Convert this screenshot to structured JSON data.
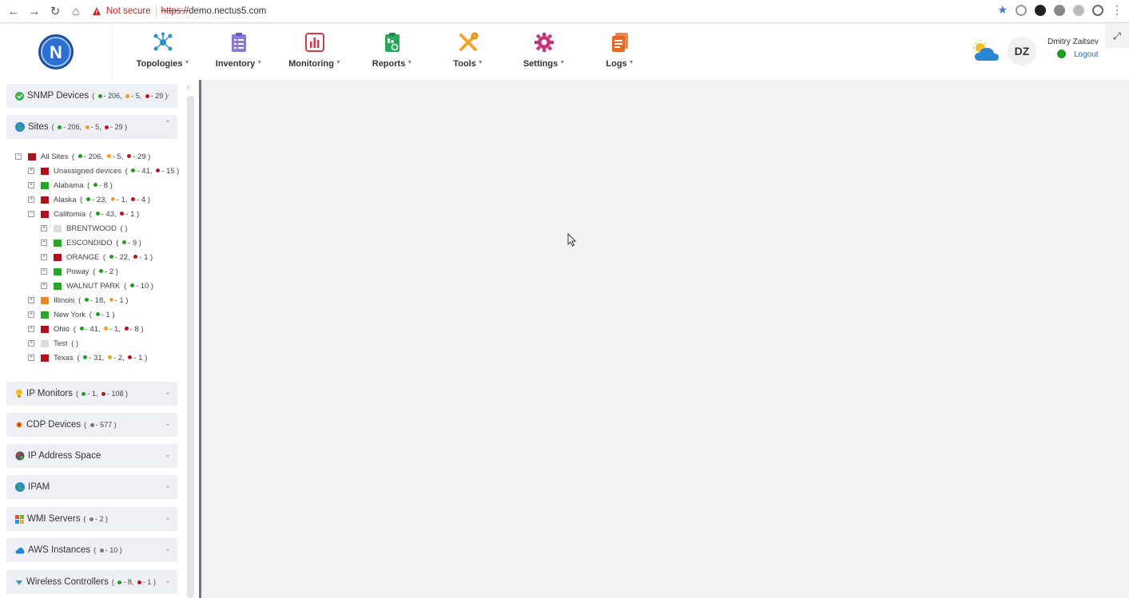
{
  "browser": {
    "not_secure": "Not secure",
    "url_scheme": "https://",
    "url_host": "demo.nectus5.com"
  },
  "header": {
    "logo_letter": "N",
    "menu": [
      {
        "label": "Topologies",
        "icon": "topology-icon"
      },
      {
        "label": "Inventory",
        "icon": "clipboard-icon"
      },
      {
        "label": "Monitoring",
        "icon": "bar-chart-icon"
      },
      {
        "label": "Reports",
        "icon": "report-icon"
      },
      {
        "label": "Tools",
        "icon": "tools-icon"
      },
      {
        "label": "Settings",
        "icon": "gear-icon"
      },
      {
        "label": "Logs",
        "icon": "logs-icon"
      }
    ],
    "user": {
      "initials": "DZ",
      "name": "Dmitry Zaitsev",
      "logout": "Logout"
    }
  },
  "sidebar": {
    "panels": {
      "snmp": {
        "title": "SNMP Devices",
        "counts": {
          "green": "206",
          "orange": "5",
          "red": "29"
        }
      },
      "sites": {
        "title": "Sites",
        "counts": {
          "green": "206",
          "orange": "5",
          "red": "29"
        }
      },
      "ip_monitors": {
        "title": "IP Monitors",
        "counts": {
          "green": "1",
          "red": "108"
        }
      },
      "cdp": {
        "title": "CDP Devices",
        "counts": {
          "grey": "577"
        }
      },
      "ip_space": {
        "title": "IP Address Space"
      },
      "ipam": {
        "title": "IPAM"
      },
      "wmi": {
        "title": "WMI Servers",
        "counts": {
          "grey": "2"
        }
      },
      "aws": {
        "title": "AWS Instances",
        "counts": {
          "grey": "10"
        }
      },
      "wireless": {
        "title": "Wireless Controllers",
        "counts": {
          "green": "8",
          "red": "1"
        }
      }
    },
    "tree": [
      {
        "name": "All Sites",
        "status": "red",
        "green": "206",
        "orange": "5",
        "red": "29"
      },
      {
        "name": "Unassigned devices",
        "status": "red",
        "green": "41",
        "red": "15"
      },
      {
        "name": "Alabama",
        "status": "green",
        "green": "8"
      },
      {
        "name": "Alaska",
        "status": "red",
        "green": "23",
        "orange": "1",
        "red": "4"
      },
      {
        "name": "California",
        "status": "red",
        "green": "43",
        "red": "1"
      },
      {
        "name": "BRENTWOOD",
        "status": "grey"
      },
      {
        "name": "ESCONDIDO",
        "status": "green",
        "green": "9"
      },
      {
        "name": "ORANGE",
        "status": "red",
        "green": "22",
        "red": "1"
      },
      {
        "name": "Poway",
        "status": "green",
        "green": "2"
      },
      {
        "name": "WALNUT PARK",
        "status": "green",
        "green": "10"
      },
      {
        "name": "Illinois",
        "status": "orange",
        "green": "18",
        "orange": "1"
      },
      {
        "name": "New York",
        "status": "green",
        "green": "1"
      },
      {
        "name": "Ohio",
        "status": "red",
        "green": "41",
        "orange": "1",
        "red": "8"
      },
      {
        "name": "Test",
        "status": "grey"
      },
      {
        "name": "Texas",
        "status": "red",
        "green": "31",
        "orange": "2",
        "red": "1"
      }
    ]
  },
  "colors": {
    "green": "#1e9e1e",
    "orange": "#f0a020",
    "red": "#c0101a",
    "accent": "#2a6db4"
  }
}
